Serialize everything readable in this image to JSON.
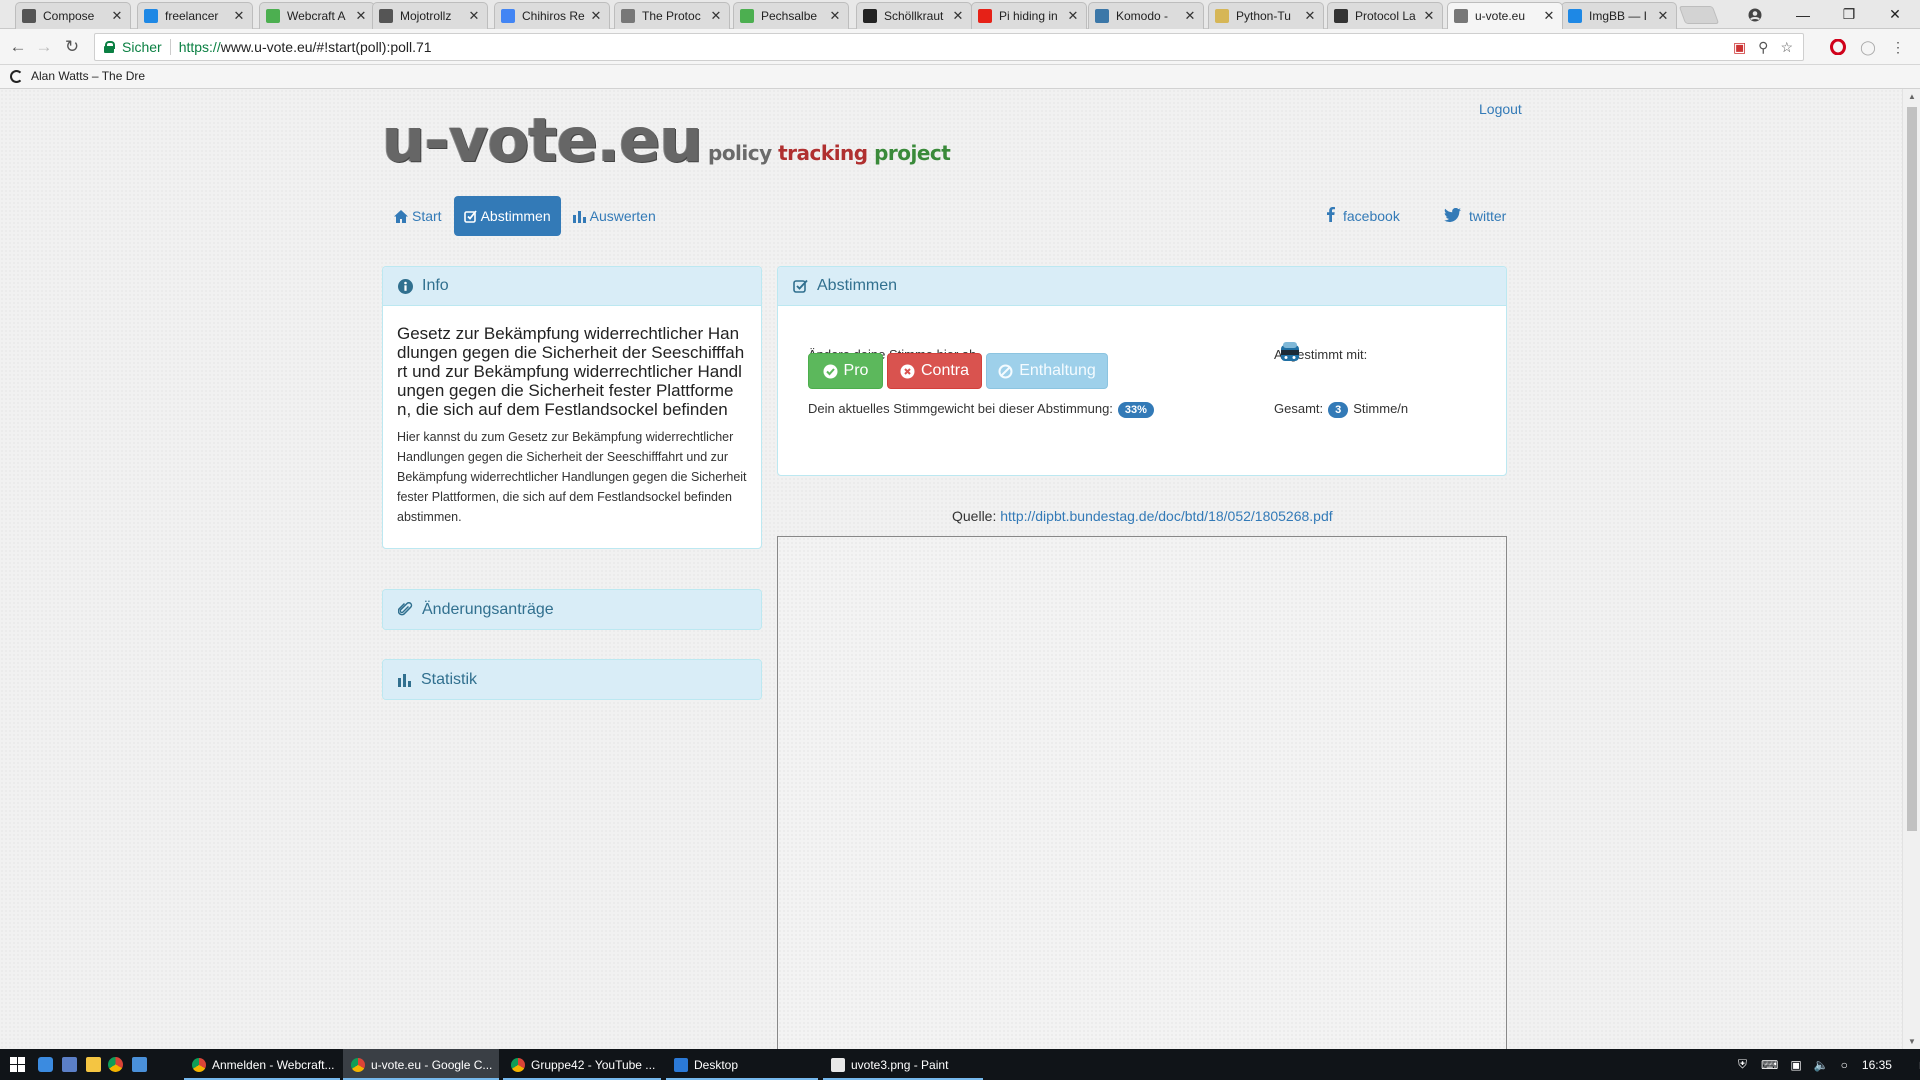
{
  "browser": {
    "tabs": [
      {
        "label": "Compose",
        "icon": "gmail-icon",
        "color": "#555555"
      },
      {
        "label": "freelancer",
        "icon": "freelancer-icon",
        "color": "#1e88e5"
      },
      {
        "label": "Webcraft A",
        "icon": "webcraft-icon",
        "color": "#4caf50"
      },
      {
        "label": "Mojotrollz",
        "icon": "mojotrollz-icon",
        "color": "#555555"
      },
      {
        "label": "Chihiros Re",
        "icon": "google-icon",
        "color": "#4285f4"
      },
      {
        "label": "The Protoc",
        "icon": "document-icon",
        "color": "#777777"
      },
      {
        "label": "Pechsalbe",
        "icon": "leaf-icon",
        "color": "#4caf50"
      },
      {
        "label": "Schöllkraut",
        "icon": "wikipedia-icon",
        "color": "#222222"
      },
      {
        "label": "Pi hiding in",
        "icon": "youtube-icon",
        "color": "#e62117"
      },
      {
        "label": "Komodo -",
        "icon": "python-icon",
        "color": "#3b77a8"
      },
      {
        "label": "Python-Tu",
        "icon": "python-tutorial-icon",
        "color": "#d6b656"
      },
      {
        "label": "Protocol La",
        "icon": "github-icon",
        "color": "#333333"
      },
      {
        "label": "u-vote.eu",
        "icon": "document-icon",
        "color": "#777777",
        "active": true
      },
      {
        "label": "ImgBB — I",
        "icon": "imgbb-icon",
        "color": "#1e88e5"
      }
    ],
    "secure_label": "Sicher",
    "url_scheme": "https://",
    "url_rest": "www.u-vote.eu/#!start(poll):poll.71",
    "bookmark_label": "Alan Watts – The Dre"
  },
  "site": {
    "logout": "Logout",
    "logo": "u-vote.eu",
    "tagline": {
      "part1": "policy ",
      "part2": "tracking",
      "part3": " ",
      "part4": "project"
    },
    "nav": {
      "start": "Start",
      "abstimmen": "Abstimmen",
      "auswerten": "Auswerten"
    },
    "social": {
      "facebook": "facebook",
      "twitter": "twitter"
    },
    "info": {
      "header": "Info",
      "title": "Gesetz zur Bekämpfung widerrechtlicher Handlungen gegen die Sicherheit der Seeschifffahrt und zur Bekämpfung widerrechtlicher Handlungen gegen die Sicherheit fester Plattformen, die sich auf dem Festlandsockel befinden",
      "text": "Hier kannst du zum  Gesetz zur Bekämpfung widerrechtlicher Handlungen gegen die Sicherheit der Seeschifffahrt und zur Bekämpfung widerrechtlicher Handlungen gegen die Sicherheit fester Plattformen, die sich auf dem Festlandsockel befinden abstimmen."
    },
    "aenderungsantraege": "Änderungsanträge",
    "statistik": "Statistik",
    "vote": {
      "header": "Abstimmen",
      "prompt": "Ändere deine Stimme hier ab",
      "pro": "Pro",
      "contra": "Contra",
      "enthaltung": "Enthaltung",
      "weight_label": "Dein aktuelles Stimmgewicht bei dieser Abstimmung:",
      "weight_value": "33%",
      "voted_with_label": "Abgestimmt mit:",
      "total_label": "Gesamt:",
      "total_value": "3",
      "total_suffix": "Stimme/n"
    },
    "source_label": "Quelle:",
    "source_link": "http://dipbt.bundestag.de/doc/btd/18/052/1805268.pdf"
  },
  "taskbar": {
    "items": [
      {
        "label": "Anmelden - Webcraft...",
        "icon": "chrome-icon"
      },
      {
        "label": "u-vote.eu - Google C...",
        "icon": "chrome-icon",
        "active": true
      },
      {
        "label": "Gruppe42 - YouTube ...",
        "icon": "chrome-icon"
      },
      {
        "label": "Desktop",
        "icon": "desktop-icon"
      },
      {
        "label": "uvote3.png - Paint",
        "icon": "paint-icon"
      }
    ],
    "clock": "16:35"
  },
  "colors": {
    "primary": "#337ab7",
    "success": "#5cb85c",
    "danger": "#d9534f",
    "info_bg": "#d9edf7"
  }
}
